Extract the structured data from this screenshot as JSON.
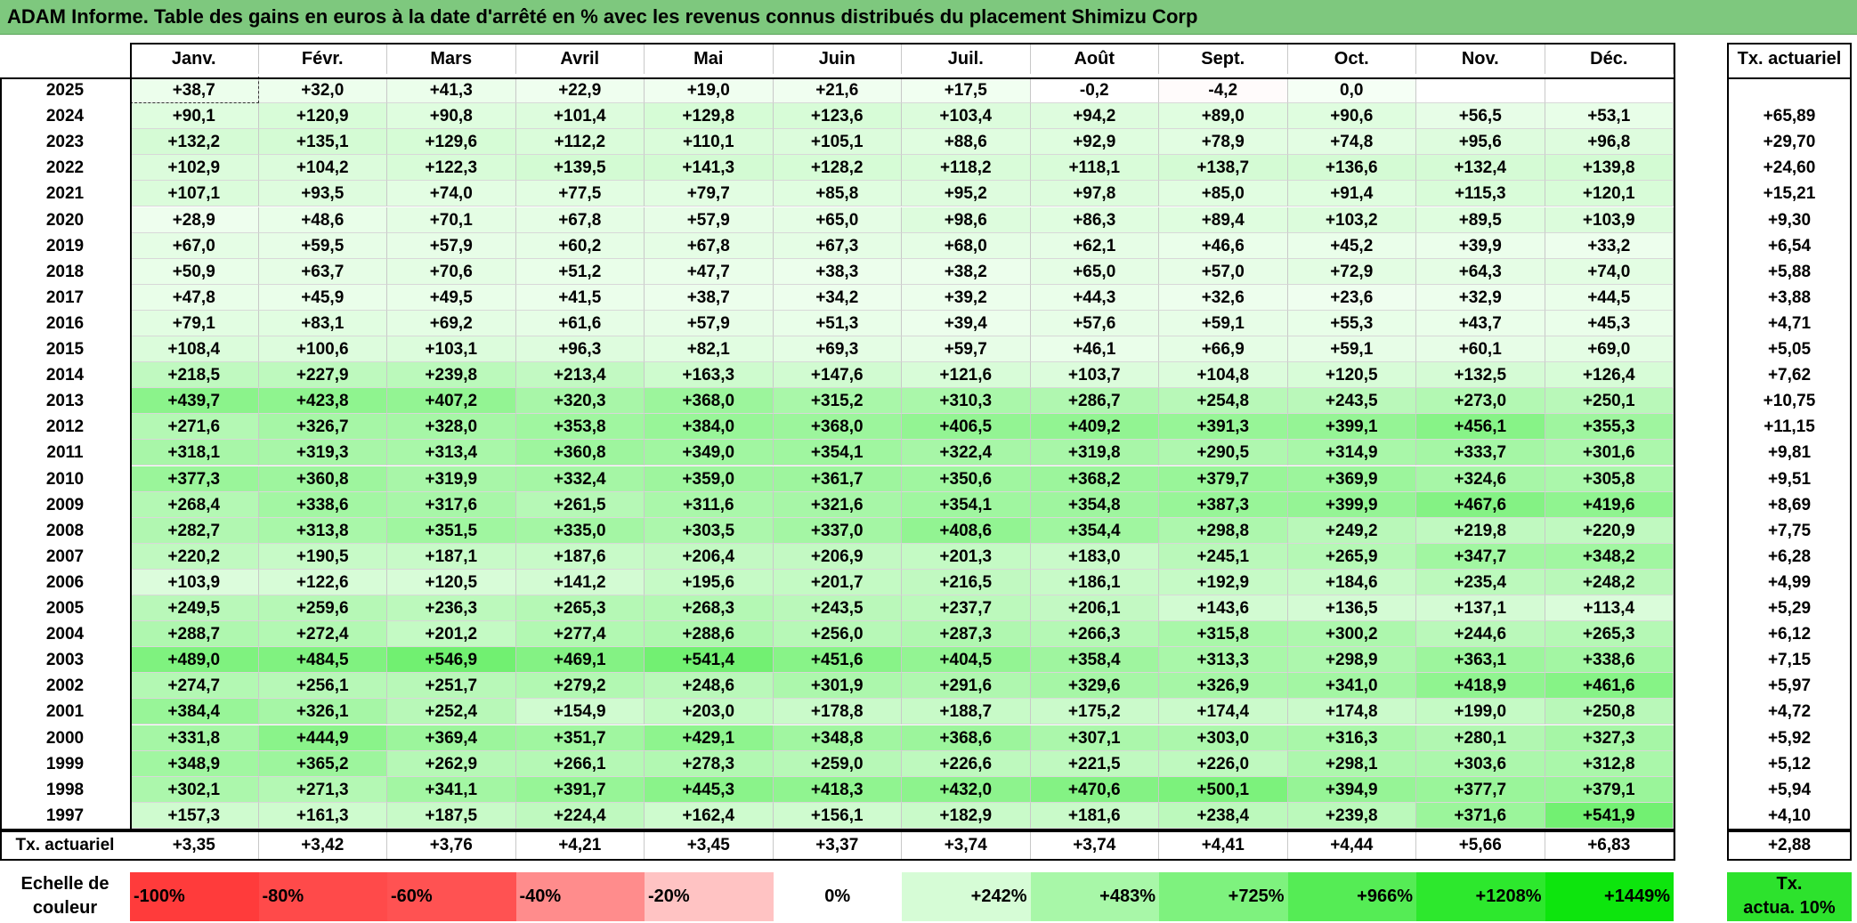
{
  "title": "ADAM Informe. Table des gains en euros à la date d'arrêté en % avec les revenus connus distribués du placement Shimizu Corp",
  "months": [
    "Janv.",
    "Févr.",
    "Mars",
    "Avril",
    "Mai",
    "Juin",
    "Juil.",
    "Août",
    "Sept.",
    "Oct.",
    "Nov.",
    "Déc."
  ],
  "tx_header": "Tx. actuariel",
  "rows": [
    {
      "year": "2025",
      "values": [
        "+38,7",
        "+32,0",
        "+41,3",
        "+22,9",
        "+19,0",
        "+21,6",
        "+17,5",
        "-0,2",
        "-4,2",
        "0,0",
        "",
        ""
      ],
      "tx": ""
    },
    {
      "year": "2024",
      "values": [
        "+90,1",
        "+120,9",
        "+90,8",
        "+101,4",
        "+129,8",
        "+123,6",
        "+103,4",
        "+94,2",
        "+89,0",
        "+90,6",
        "+56,5",
        "+53,1"
      ],
      "tx": "+65,89"
    },
    {
      "year": "2023",
      "values": [
        "+132,2",
        "+135,1",
        "+129,6",
        "+112,2",
        "+110,1",
        "+105,1",
        "+88,6",
        "+92,9",
        "+78,9",
        "+74,8",
        "+95,6",
        "+96,8"
      ],
      "tx": "+29,70"
    },
    {
      "year": "2022",
      "values": [
        "+102,9",
        "+104,2",
        "+122,3",
        "+139,5",
        "+141,3",
        "+128,2",
        "+118,2",
        "+118,1",
        "+138,7",
        "+136,6",
        "+132,4",
        "+139,8"
      ],
      "tx": "+24,60"
    },
    {
      "year": "2021",
      "values": [
        "+107,1",
        "+93,5",
        "+74,0",
        "+77,5",
        "+79,7",
        "+85,8",
        "+95,2",
        "+97,8",
        "+85,0",
        "+91,4",
        "+115,3",
        "+120,1"
      ],
      "tx": "+15,21"
    },
    {
      "year": "2020",
      "values": [
        "+28,9",
        "+48,6",
        "+70,1",
        "+67,8",
        "+57,9",
        "+65,0",
        "+98,6",
        "+86,3",
        "+89,4",
        "+103,2",
        "+89,5",
        "+103,9"
      ],
      "tx": "+9,30"
    },
    {
      "year": "2019",
      "values": [
        "+67,0",
        "+59,5",
        "+57,9",
        "+60,2",
        "+67,8",
        "+67,3",
        "+68,0",
        "+62,1",
        "+46,6",
        "+45,2",
        "+39,9",
        "+33,2"
      ],
      "tx": "+6,54"
    },
    {
      "year": "2018",
      "values": [
        "+50,9",
        "+63,7",
        "+70,6",
        "+51,2",
        "+47,7",
        "+38,3",
        "+38,2",
        "+65,0",
        "+57,0",
        "+72,9",
        "+64,3",
        "+74,0"
      ],
      "tx": "+5,88"
    },
    {
      "year": "2017",
      "values": [
        "+47,8",
        "+45,9",
        "+49,5",
        "+41,5",
        "+38,7",
        "+34,2",
        "+39,2",
        "+44,3",
        "+32,6",
        "+23,6",
        "+32,9",
        "+44,5"
      ],
      "tx": "+3,88"
    },
    {
      "year": "2016",
      "values": [
        "+79,1",
        "+83,1",
        "+69,2",
        "+61,6",
        "+57,9",
        "+51,3",
        "+39,4",
        "+57,6",
        "+59,1",
        "+55,3",
        "+43,7",
        "+45,3"
      ],
      "tx": "+4,71"
    },
    {
      "year": "2015",
      "values": [
        "+108,4",
        "+100,6",
        "+103,1",
        "+96,3",
        "+82,1",
        "+69,3",
        "+59,7",
        "+46,1",
        "+66,9",
        "+59,1",
        "+60,1",
        "+69,0"
      ],
      "tx": "+5,05"
    },
    {
      "year": "2014",
      "values": [
        "+218,5",
        "+227,9",
        "+239,8",
        "+213,4",
        "+163,3",
        "+147,6",
        "+121,6",
        "+103,7",
        "+104,8",
        "+120,5",
        "+132,5",
        "+126,4"
      ],
      "tx": "+7,62"
    },
    {
      "year": "2013",
      "values": [
        "+439,7",
        "+423,8",
        "+407,2",
        "+320,3",
        "+368,0",
        "+315,2",
        "+310,3",
        "+286,7",
        "+254,8",
        "+243,5",
        "+273,0",
        "+250,1"
      ],
      "tx": "+10,75"
    },
    {
      "year": "2012",
      "values": [
        "+271,6",
        "+326,7",
        "+328,0",
        "+353,8",
        "+384,0",
        "+368,0",
        "+406,5",
        "+409,2",
        "+391,3",
        "+399,1",
        "+456,1",
        "+355,3"
      ],
      "tx": "+11,15"
    },
    {
      "year": "2011",
      "values": [
        "+318,1",
        "+319,3",
        "+313,4",
        "+360,8",
        "+349,0",
        "+354,1",
        "+322,4",
        "+319,8",
        "+290,5",
        "+314,9",
        "+333,7",
        "+301,6"
      ],
      "tx": "+9,81"
    },
    {
      "year": "2010",
      "values": [
        "+377,3",
        "+360,8",
        "+319,9",
        "+332,4",
        "+359,0",
        "+361,7",
        "+350,6",
        "+368,2",
        "+379,7",
        "+369,9",
        "+324,6",
        "+305,8"
      ],
      "tx": "+9,51"
    },
    {
      "year": "2009",
      "values": [
        "+268,4",
        "+338,6",
        "+317,6",
        "+261,5",
        "+311,6",
        "+321,6",
        "+354,1",
        "+354,8",
        "+387,3",
        "+399,9",
        "+467,6",
        "+419,6"
      ],
      "tx": "+8,69"
    },
    {
      "year": "2008",
      "values": [
        "+282,7",
        "+313,8",
        "+351,5",
        "+335,0",
        "+303,5",
        "+337,0",
        "+408,6",
        "+354,4",
        "+298,8",
        "+249,2",
        "+219,8",
        "+220,9"
      ],
      "tx": "+7,75"
    },
    {
      "year": "2007",
      "values": [
        "+220,2",
        "+190,5",
        "+187,1",
        "+187,6",
        "+206,4",
        "+206,9",
        "+201,3",
        "+183,0",
        "+245,1",
        "+265,9",
        "+347,7",
        "+348,2"
      ],
      "tx": "+6,28"
    },
    {
      "year": "2006",
      "values": [
        "+103,9",
        "+122,6",
        "+120,5",
        "+141,2",
        "+195,6",
        "+201,7",
        "+216,5",
        "+186,1",
        "+192,9",
        "+184,6",
        "+235,4",
        "+248,2"
      ],
      "tx": "+4,99"
    },
    {
      "year": "2005",
      "values": [
        "+249,5",
        "+259,6",
        "+236,3",
        "+265,3",
        "+268,3",
        "+243,5",
        "+237,7",
        "+206,1",
        "+143,6",
        "+136,5",
        "+137,1",
        "+113,4"
      ],
      "tx": "+5,29"
    },
    {
      "year": "2004",
      "values": [
        "+288,7",
        "+272,4",
        "+201,2",
        "+277,4",
        "+288,6",
        "+256,0",
        "+287,3",
        "+266,3",
        "+315,8",
        "+300,2",
        "+244,6",
        "+265,3"
      ],
      "tx": "+6,12"
    },
    {
      "year": "2003",
      "values": [
        "+489,0",
        "+484,5",
        "+546,9",
        "+469,1",
        "+541,4",
        "+451,6",
        "+404,5",
        "+358,4",
        "+313,3",
        "+298,9",
        "+363,1",
        "+338,6"
      ],
      "tx": "+7,15"
    },
    {
      "year": "2002",
      "values": [
        "+274,7",
        "+256,1",
        "+251,7",
        "+279,2",
        "+248,6",
        "+301,9",
        "+291,6",
        "+329,6",
        "+326,9",
        "+341,0",
        "+418,9",
        "+461,6"
      ],
      "tx": "+5,97"
    },
    {
      "year": "2001",
      "values": [
        "+384,4",
        "+326,1",
        "+252,4",
        "+154,9",
        "+203,0",
        "+178,8",
        "+188,7",
        "+175,2",
        "+174,4",
        "+174,8",
        "+199,0",
        "+250,8"
      ],
      "tx": "+4,72"
    },
    {
      "year": "2000",
      "values": [
        "+331,8",
        "+444,9",
        "+369,4",
        "+351,7",
        "+429,1",
        "+348,8",
        "+368,6",
        "+307,1",
        "+303,0",
        "+316,3",
        "+280,1",
        "+327,3"
      ],
      "tx": "+5,92"
    },
    {
      "year": "1999",
      "values": [
        "+348,9",
        "+365,2",
        "+262,9",
        "+266,1",
        "+278,3",
        "+259,0",
        "+226,6",
        "+221,5",
        "+226,0",
        "+298,1",
        "+303,6",
        "+312,8"
      ],
      "tx": "+5,12"
    },
    {
      "year": "1998",
      "values": [
        "+302,1",
        "+271,3",
        "+341,1",
        "+391,7",
        "+445,3",
        "+418,3",
        "+432,0",
        "+470,6",
        "+500,1",
        "+394,9",
        "+377,7",
        "+379,1"
      ],
      "tx": "+5,94"
    },
    {
      "year": "1997",
      "values": [
        "+157,3",
        "+161,3",
        "+187,5",
        "+224,4",
        "+162,4",
        "+156,1",
        "+182,9",
        "+181,6",
        "+238,4",
        "+239,8",
        "+371,6",
        "+541,9"
      ],
      "tx": "+4,10"
    }
  ],
  "summary": {
    "label": "Tx. actuariel",
    "values": [
      "+3,35",
      "+3,42",
      "+3,76",
      "+4,21",
      "+3,45",
      "+3,37",
      "+3,74",
      "+3,74",
      "+4,41",
      "+4,44",
      "+5,66",
      "+6,83"
    ],
    "tx": "+2,88"
  },
  "scale": {
    "label_line1": "Echelle de",
    "label_line2": "couleur",
    "items": [
      {
        "label": "-100%",
        "color": "#ff3b3b",
        "align": "left"
      },
      {
        "label": "-80%",
        "color": "#ff4a4a",
        "align": "left"
      },
      {
        "label": "-60%",
        "color": "#ff5252",
        "align": "left"
      },
      {
        "label": "-40%",
        "color": "#ff8c8c",
        "align": "left"
      },
      {
        "label": "-20%",
        "color": "#ffc3c3",
        "align": "left"
      },
      {
        "label": "0%",
        "color": "#ffffff",
        "align": "center"
      },
      {
        "label": "+242%",
        "color": "#d6fcd6",
        "align": "right"
      },
      {
        "label": "+483%",
        "color": "#a8f7a8",
        "align": "right"
      },
      {
        "label": "+725%",
        "color": "#7ef27e",
        "align": "right"
      },
      {
        "label": "+966%",
        "color": "#55ec55",
        "align": "right"
      },
      {
        "label": "+1208%",
        "color": "#2de82d",
        "align": "right"
      },
      {
        "label": "+1449%",
        "color": "#0de50d",
        "align": "right"
      }
    ],
    "tx_label_line1": "Tx.",
    "tx_label_line2": "actua. 10%",
    "tx_color": "#2de22d"
  },
  "colors": {
    "title_bg": "#7ec87e"
  }
}
